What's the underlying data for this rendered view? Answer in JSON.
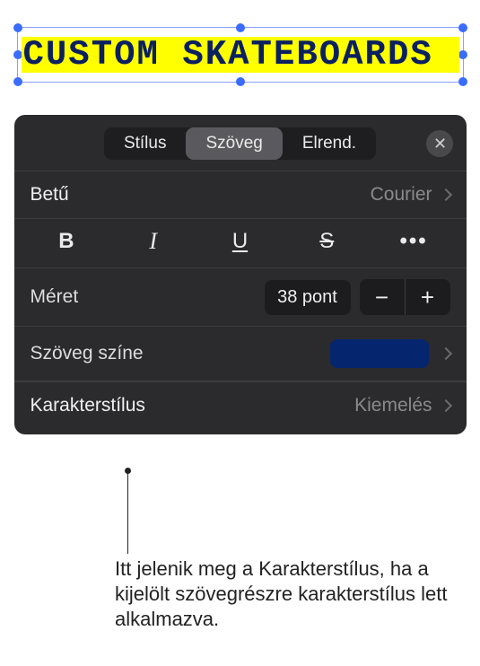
{
  "text_sample": "CUSTOM SKATEBOARDS",
  "tabs": {
    "style": "Stílus",
    "text": "Szöveg",
    "layout": "Elrend."
  },
  "font": {
    "label": "Betű",
    "value": "Courier"
  },
  "format": {
    "more": "•••"
  },
  "size": {
    "label": "Méret",
    "value": "38 pont"
  },
  "textcolor": {
    "label": "Szöveg színe",
    "swatch": "#06256f"
  },
  "charstyle": {
    "label": "Karakterstílus",
    "value": "Kiemelés"
  },
  "caption": "Itt jelenik meg a Karakterstílus, ha a kijelölt szövegrészre karakterstílus lett alkalmazva."
}
